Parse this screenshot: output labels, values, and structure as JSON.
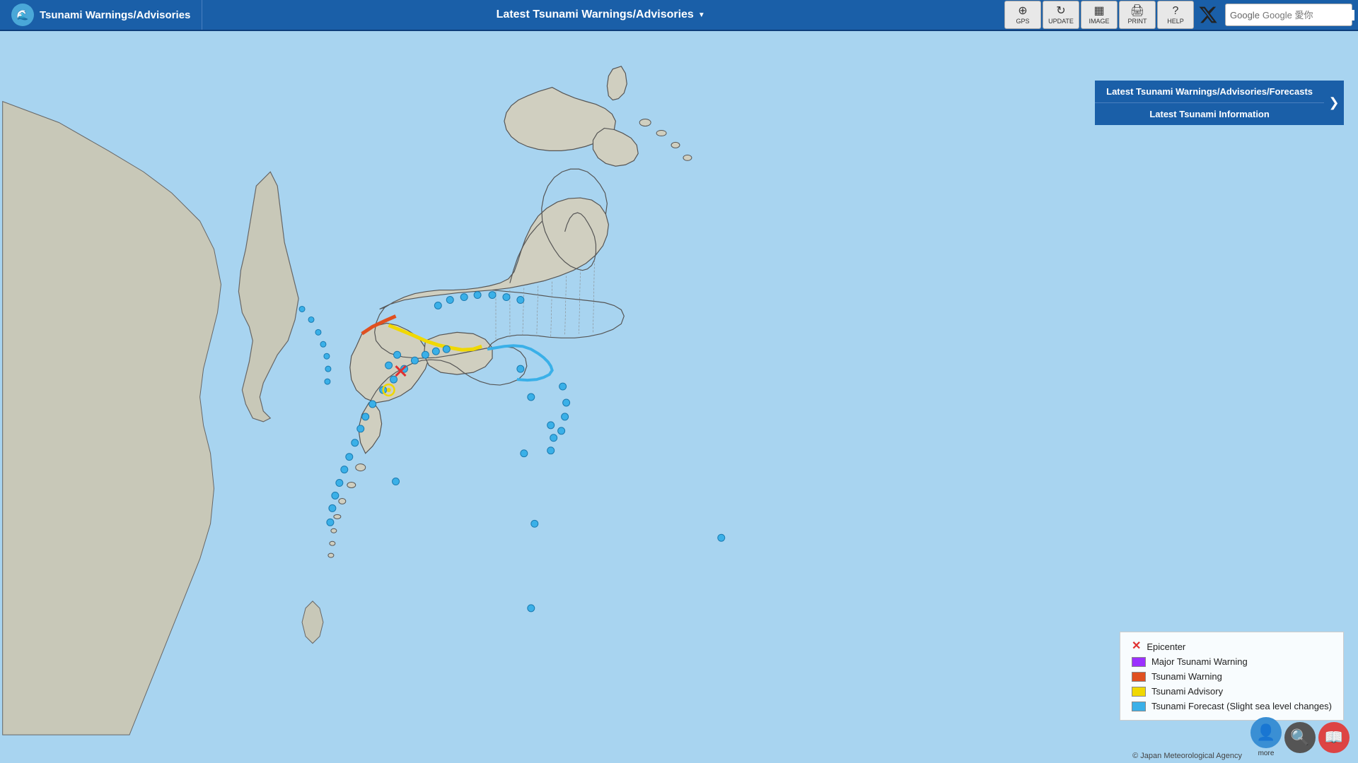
{
  "header": {
    "logo_text": "Tsunami Warnings/Advisories",
    "center_title": "Latest Tsunami Warnings/Advisories",
    "center_arrow": "▼",
    "tools": [
      {
        "id": "gps",
        "icon": "📍",
        "label": "GPS"
      },
      {
        "id": "update",
        "icon": "🔄",
        "label": "UPDATE"
      },
      {
        "id": "image",
        "icon": "🖼",
        "label": "IMAGE"
      },
      {
        "id": "print",
        "icon": "🖨",
        "label": "PRINT"
      },
      {
        "id": "help",
        "icon": "❓",
        "label": "HELP"
      }
    ],
    "search_placeholder": "Google 愛你"
  },
  "info_panel": {
    "btn1_label": "Latest Tsunami Warnings/Advisories/Forecasts",
    "btn2_label": "Latest Tsunami Information",
    "arrow": "❯"
  },
  "legend": {
    "items": [
      {
        "type": "x",
        "label": "Epicenter",
        "color": null
      },
      {
        "type": "box",
        "label": "Major Tsunami Warning",
        "color": "#9b30ff"
      },
      {
        "type": "box",
        "label": "Tsunami Warning",
        "color": "#e05020"
      },
      {
        "type": "box",
        "label": "Tsunami Advisory",
        "color": "#f0d800"
      },
      {
        "type": "box",
        "label": "Tsunami Forecast (Slight sea level changes)",
        "color": "#3ab0e8"
      }
    ]
  },
  "copyright": "© Japan Meteorological Agency",
  "bottom_tools": [
    {
      "id": "person",
      "icon": "👤",
      "label": "more"
    },
    {
      "id": "search",
      "icon": "🔍",
      "label": ""
    },
    {
      "id": "book",
      "icon": "📖",
      "label": ""
    }
  ]
}
